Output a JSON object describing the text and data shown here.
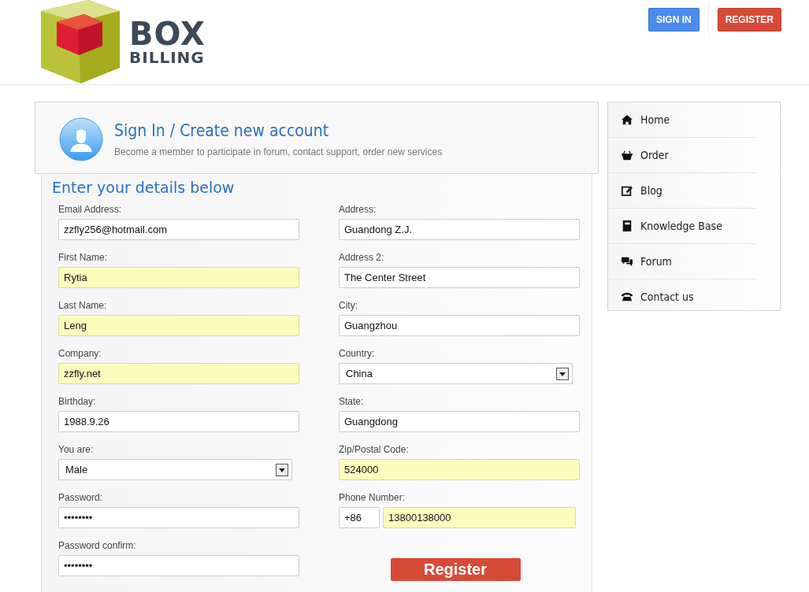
{
  "logo": {
    "line_1": "BOX",
    "line_2": "BILLING"
  },
  "header_buttons": [
    {
      "label": "SIGN IN",
      "kind": "primary"
    },
    {
      "label": "REGISTER",
      "kind": "danger"
    }
  ],
  "intro": {
    "title": "Sign In / Create new account",
    "subtitle": "Become a member to participate in forum, contact support, order new services"
  },
  "form": {
    "title": "Enter your details below",
    "left_fields": [
      {
        "kind": "text",
        "label": "Email Address:",
        "value": "zzfly256@hotmail.com",
        "autofilled": false
      },
      {
        "kind": "text",
        "label": "First Name:",
        "value": "Rytia",
        "autofilled": true
      },
      {
        "kind": "text",
        "label": "Last Name:",
        "value": "Leng",
        "autofilled": true
      },
      {
        "kind": "text",
        "label": "Company:",
        "value": "zzfly.net",
        "autofilled": true
      },
      {
        "kind": "text",
        "label": "Birthday:",
        "value": "1988.9.26",
        "autofilled": false
      },
      {
        "kind": "select",
        "label": "You are:",
        "value": "Male"
      },
      {
        "kind": "text",
        "label": "Password:",
        "value": "••••••••",
        "autofilled": false
      },
      {
        "kind": "text",
        "label": "Password confirm:",
        "value": "••••••••",
        "autofilled": false
      }
    ],
    "right_fields": [
      {
        "kind": "text",
        "label": "Address:",
        "value": "Guandong Z.J.",
        "autofilled": false
      },
      {
        "kind": "text",
        "label": "Address 2:",
        "value": "The Center Street",
        "autofilled": false
      },
      {
        "kind": "text",
        "label": "City:",
        "value": "Guangzhou",
        "autofilled": false
      },
      {
        "kind": "select",
        "label": "Country:",
        "value": "China"
      },
      {
        "kind": "text",
        "label": "State:",
        "value": "Guangdong",
        "autofilled": false
      },
      {
        "kind": "text",
        "label": "Zip/Postal Code:",
        "value": "524000",
        "autofilled": true
      },
      {
        "kind": "phone",
        "label": "Phone Number:",
        "prefix": {
          "value": "+86",
          "autofilled": false
        },
        "number": {
          "value": "13800138000",
          "autofilled": true
        }
      }
    ],
    "submit": "Register"
  },
  "sidebar": {
    "items": [
      {
        "label": "Home"
      },
      {
        "label": "Order"
      },
      {
        "label": "Blog"
      },
      {
        "label": "Knowledge Base"
      },
      {
        "label": "Forum"
      },
      {
        "label": "Contact us"
      }
    ]
  }
}
